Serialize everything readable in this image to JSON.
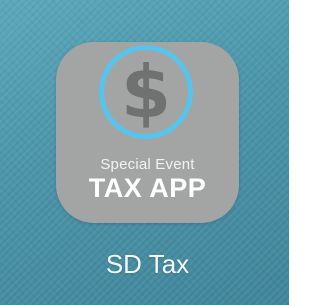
{
  "app": {
    "icon_symbol": "$",
    "icon_name": "dollar-coin-icon",
    "icon_subtitle": "Special Event",
    "icon_title": "TAX APP",
    "label": "SD Tax"
  },
  "colors": {
    "wallpaper": "#4f98ad",
    "icon_background": "#a3a4a4",
    "coin_ring": "#55c5ee",
    "dollar_glyph": "#707272",
    "text": "#ffffff"
  }
}
